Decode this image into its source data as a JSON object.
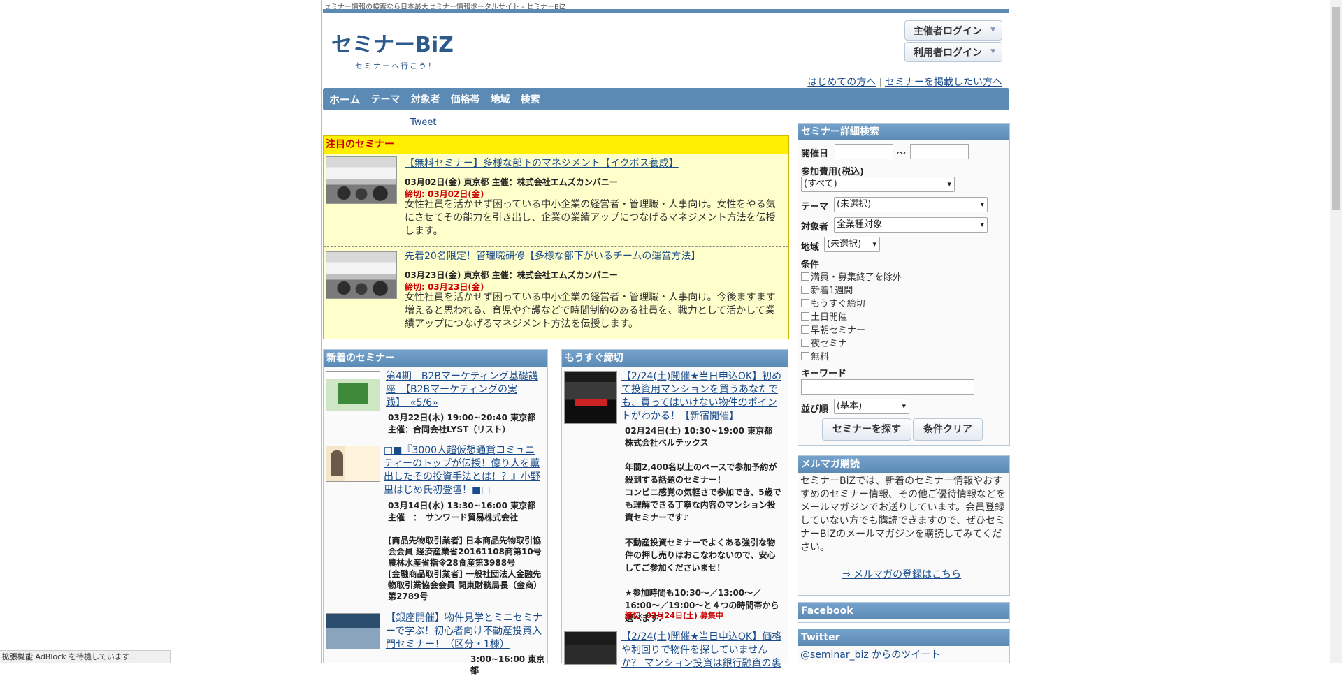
{
  "site": {
    "tagline": "セミナー情報の検索なら日本最大セミナー情報ポータルサイト - セミナーBiZ",
    "logo_text": "セミナーBiZ",
    "logo_sub": "セミナーへ行こう！",
    "brand_color": "#5b8ab5"
  },
  "header": {
    "organizer_login": "主催者ログイン",
    "user_login": "利用者ログイン",
    "first_time_link": "はじめての方へ",
    "post_seminar_link": "セミナーを掲載したい方へ",
    "separator": "|"
  },
  "nav": {
    "items": [
      "ホーム",
      "テーマ",
      "対象者",
      "価格帯",
      "地域",
      "検索"
    ]
  },
  "tweet_label": "Tweet",
  "featured": {
    "heading": "注目のセミナー",
    "items": [
      {
        "title": "【無料セミナー】多様な部下のマネジメント【イクボス養成】",
        "meta": "03月02日(金) 東京都 主催：株式会社エムズカンパニー",
        "deadline": "締切: 03月02日(金)",
        "desc": "女性社員を活かせず困っている中小企業の経営者・管理職・人事向け。女性をやる気にさせてその能力を引き出し、企業の業績アップにつなげるマネジメント方法を伝授します。"
      },
      {
        "title": "先着20名限定！管理職研修【多様な部下がいるチームの運営方法】",
        "meta": "03月23日(金) 東京都 主催：株式会社エムズカンパニー",
        "deadline": "締切: 03月23日(金)",
        "desc": "女性社員を活かせず困っている中小企業の経営者・管理職・人事向け。今後ますます増えると思われる、育児や介護などで時間制約のある社員を、戦力として活かして業績アップにつなげるマネジメント方法を伝授します。"
      }
    ]
  },
  "new_seminars": {
    "heading": "新着のセミナー",
    "items": [
      {
        "title": "第4期　B2Bマーケティング基礎講座　【B2Bマーケティングの実践】　«5/6»",
        "line1": "03月22日(木) 19:00~20:40 東京都",
        "line2": "主催：合同会社LYST（リスト）"
      },
      {
        "title": "□■『3000人超仮想通貨コミュニティーのトップが伝授！億り人を薫出したその投資手法とは！？』小野里はじめ氏初登壇！■□",
        "line1": "03月14日(水) 13:30~16:00 東京都",
        "line2": "主催　：　サンワード貿易株式会社",
        "extra": "[商品先物取引業者] 日本商品先物取引協会会員 経済産業省20161108商第10号 農林水産省指令28食産第3988号\n[金融商品取引業者] 一般社団法人金融先物取引業協会会員 関東財務局長（金商）第2789号"
      },
      {
        "title": "【銀座開催】物件見学とミニセミナーで学ぶ！初心者向け不動産投資入門セミナー！（区分・1棟）",
        "line1": "3:00~16:00 東京都"
      }
    ]
  },
  "closing_soon": {
    "heading": "もうすぐ締切",
    "items": [
      {
        "title": "【2/24(土)開催★当日申込OK】初めて投資用マンションを買うあなたでも、買ってはいけない物件のポイントがわかる！【新宿開催】",
        "line1": "02月24日(土) 10:30~19:00 東京都",
        "line2": "株式会社ベルテックス",
        "body": "年間2,400名以上のペースで参加予約が殺到する話題のセミナー！\nコンビニ感覚の気軽さで参加でき、5歳でも理解できる丁寧な内容のマンション投資セミナーです♪\n\n不動産投資セミナーでよくある強引な物件の押し売りはおこなわないので、安心してご参加くださいませ！\n\n★参加時間も10:30～／13:00～／16:00～／19:00～と４つの時間帯から選べます♪",
        "deadline": "締切: 02月24日(土) 募集中"
      },
      {
        "title": "【2/24(土)開催★当日申込OK】価格や利回りで物件を探していませんか？ マンション投資は銀行融資の裏"
      }
    ]
  },
  "search": {
    "heading": "セミナー詳細検索",
    "date_label": "開催日",
    "date_sep": "～",
    "fee_label": "参加費用(税込)",
    "fee_value": "(すべて)",
    "theme_label": "テーマ",
    "theme_value": "(未選択)",
    "target_label": "対象者",
    "target_value": "全業種対象",
    "region_label": "地域",
    "region_value": "(未選択)",
    "conditions_label": "条件",
    "conditions": [
      "満員・募集終了を除外",
      "新着1週間",
      "もうすぐ締切",
      "土日開催",
      "早朝セミナー",
      "夜セミナ",
      "無料"
    ],
    "keyword_label": "キーワード",
    "sort_label": "並び順",
    "sort_value": "(基本)",
    "search_button": "セミナーを探す",
    "clear_button": "条件クリア"
  },
  "newsletter": {
    "heading": "メルマガ購読",
    "text": "セミナーBiZでは、新着のセミナー情報やおすすめのセミナー情報、その他ご優待情報などをメールマガジンでお送りしています。会員登録していない方でも購読できますので、ぜひセミナーBiZのメールマガジンを購読してみてください。",
    "link": "⇒ メルマガの登録はこちら"
  },
  "facebook_heading": "Facebook",
  "twitter": {
    "heading": "Twitter",
    "link": "@seminar_biz からのツイート"
  },
  "status_bar": "拡張機能 AdBlock を待機しています..."
}
